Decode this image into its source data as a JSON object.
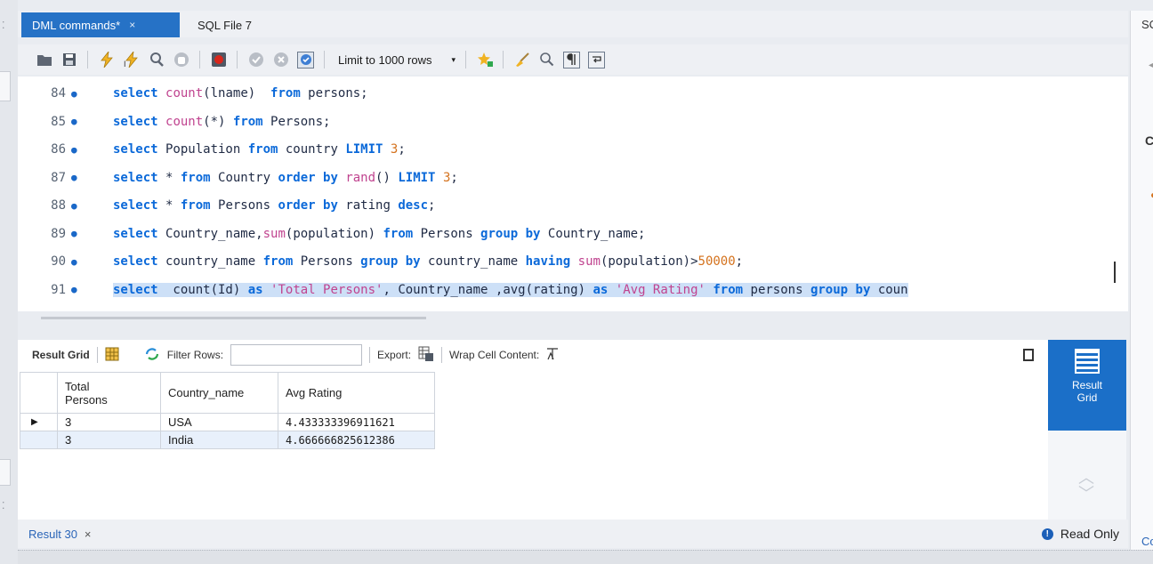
{
  "tabs": [
    {
      "label": "DML commands*",
      "close": "×",
      "active": true
    },
    {
      "label": "SQL File 7",
      "active": false
    }
  ],
  "toolbar": {
    "icons": [
      "open-file-icon",
      "save-icon",
      "execute-icon",
      "execute-current-icon",
      "explain-icon",
      "stop-icon",
      "toggle-error-icon",
      "commit-icon",
      "rollback-icon",
      "autocommit-icon",
      "beautify-icon",
      "find-icon",
      "invisible-chars-icon",
      "wrap-icon"
    ],
    "limit_label": "Limit to 1000 rows",
    "limit_arrow": "▾"
  },
  "editor": {
    "lines": [
      {
        "num": "84",
        "html": "<span class=\"kw\">select</span> <span class=\"fn\">count</span>(lname)  <span class=\"kw\">from</span> persons;"
      },
      {
        "num": "85",
        "html": "<span class=\"kw\">select</span> <span class=\"fn\">count</span>(*) <span class=\"kw\">from</span> Persons;"
      },
      {
        "num": "86",
        "html": "<span class=\"kw\">select</span> Population <span class=\"kw\">from</span> country <span class=\"kw\">LIMIT</span> <span class=\"num\">3</span>;"
      },
      {
        "num": "87",
        "html": "<span class=\"kw\">select</span> * <span class=\"kw\">from</span> Country <span class=\"kw\">order by</span> <span class=\"fn\">rand</span>() <span class=\"kw\">LIMIT</span> <span class=\"num\">3</span>;"
      },
      {
        "num": "88",
        "html": "<span class=\"kw\">select</span> * <span class=\"kw\">from</span> Persons <span class=\"kw\">order by</span> rating <span class=\"kw\">desc</span>;"
      },
      {
        "num": "89",
        "html": "<span class=\"kw\">select</span> Country_name,<span class=\"fn\">sum</span>(population) <span class=\"kw\">from</span> Persons <span class=\"kw\">group by</span> Country_name;"
      },
      {
        "num": "90",
        "html": "<span class=\"kw\">select</span> country_name <span class=\"kw\">from</span> Persons <span class=\"kw\">group by</span> country_name <span class=\"kw\">having</span> <span class=\"fn\">sum</span>(population)><span class=\"num\">50000</span>;"
      },
      {
        "num": "91",
        "html": "<span class=\"kw\">select</span>  count(Id) <span class=\"kw\">as</span> <span class=\"str\">'Total Persons'</span>, Country_name ,avg(rating) <span class=\"kw\">as</span> <span class=\"str\">'Avg Rating'</span> <span class=\"kw\">from</span> persons <span class=\"kw\">group by</span> coun",
        "selected": true
      }
    ]
  },
  "result_toolbar": {
    "result_grid_label": "Result Grid",
    "filter_label": "Filter Rows:",
    "filter_value": "",
    "export_label": "Export:",
    "wrap_label": "Wrap Cell Content:"
  },
  "grid": {
    "headers": [
      "Total\nPersons",
      "Country_name",
      "Avg Rating"
    ],
    "header_total": "Total",
    "header_persons": "Persons",
    "header_country": "Country_name",
    "header_avg": "Avg Rating",
    "rows": [
      {
        "marker": "▶",
        "total": "3",
        "country": "USA",
        "avg": "4.433333396911621"
      },
      {
        "marker": "",
        "total": "3",
        "country": "India",
        "avg": "4.666666825612386"
      }
    ]
  },
  "side_panel": {
    "result_grid_line1": "Result",
    "result_grid_line2": "Grid"
  },
  "status": {
    "result_tab": "Result 30",
    "result_tab_close": "×",
    "readonly": "Read Only"
  },
  "right_panel": {
    "tab": "SC",
    "letter": "C",
    "bottom": "Co"
  },
  "colors": {
    "accent": "#2672c6",
    "keyword": "#0b69d9",
    "selection": "#cde0f7"
  }
}
